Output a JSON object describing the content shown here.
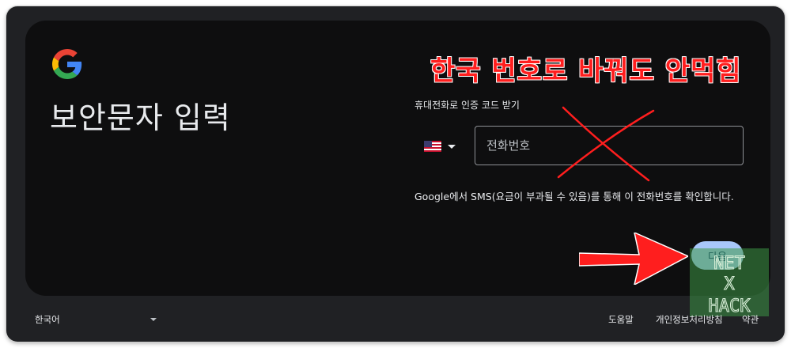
{
  "header": {
    "logo_icon": "google-g-logo",
    "title": "보안문자 입력"
  },
  "annotation": {
    "text": "한국 번호로 바꿔도 안먹힘",
    "color": "#ff1e1e"
  },
  "form": {
    "section_label": "휴대전화로 인증 코드 받기",
    "country_flag_icon": "us-flag-icon",
    "phone_placeholder": "전화번호",
    "phone_value": "",
    "help_text": "Google에서 SMS(요금이 부과될 수 있음)를 통해 이 전화번호를 확인합니다."
  },
  "actions": {
    "next_label": "다음",
    "next_color": "#a8c7fa"
  },
  "footer": {
    "language": "한국어",
    "links": [
      "도움말",
      "개인정보처리방침",
      "약관"
    ]
  },
  "watermark": {
    "lines": [
      "NET",
      "X",
      "HACK"
    ]
  }
}
